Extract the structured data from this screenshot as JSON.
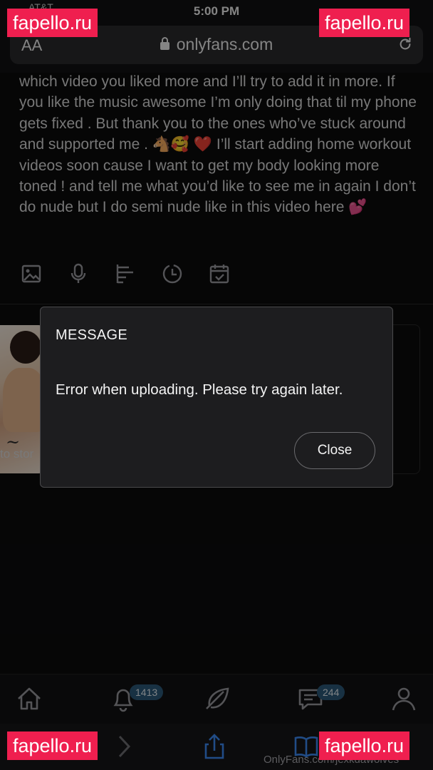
{
  "status_bar": {
    "time": "5:00 PM",
    "carrier": "AT&T"
  },
  "browser": {
    "text_size_label": "AA",
    "url": "onlyfans.com"
  },
  "post": {
    "text": "which video you liked more and I’ll try to add it in more. If you like the music awesome I’m only doing that til my phone gets fixed . But thank you to the ones who’ve stuck around and supported me . 🐴🥰 ❤️ I’ll start adding home workout videos soon cause I want to get my body looking more toned ! and tell me what you’d like to see me in again I don’t do nude but I do semi nude like in this video here 💕",
    "actions": [
      "image-icon",
      "microphone-icon",
      "poll-icon",
      "clock-icon",
      "calendar-check-icon"
    ]
  },
  "story": {
    "label": "to stor"
  },
  "modal": {
    "title": "MESSAGE",
    "body": "Error when uploading. Please try again later.",
    "close_label": "Close"
  },
  "bottom_nav": {
    "items": [
      "home-icon",
      "bell-icon",
      "feather-icon",
      "messages-icon",
      "profile-icon"
    ],
    "notifications_badge": "1413",
    "messages_badge": "244",
    "badge_color": "#2d5a7a"
  },
  "safari_toolbar": {
    "items": [
      "back-icon",
      "forward-icon",
      "share-icon",
      "bookmarks-icon",
      "tabs-icon"
    ]
  },
  "footer_url": "OnlyFans.com/jexkdawolves",
  "watermarks": [
    "fapello.ru",
    "fapello.ru",
    "fapello.ru",
    "fapello.ru"
  ],
  "colors": {
    "watermark": "#ef1f4f",
    "modal_bg": "#1d1d1f",
    "page_bg": "#0b0b0c"
  }
}
